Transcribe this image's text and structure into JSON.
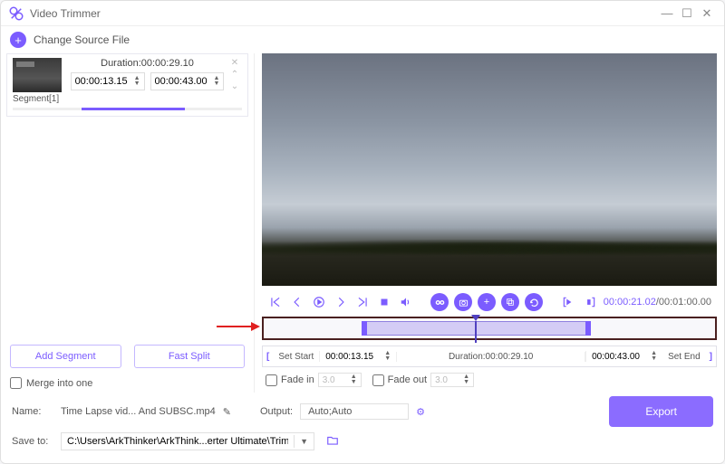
{
  "window": {
    "title": "Video Trimmer"
  },
  "header": {
    "change_source": "Change Source File"
  },
  "segment": {
    "duration_label": "Duration:00:00:29.10",
    "start_time": "00:00:13.15",
    "end_time": "00:00:43.00",
    "label": "Segment[1]"
  },
  "left": {
    "add_segment": "Add Segment",
    "fast_split": "Fast Split",
    "merge_label": "Merge into one"
  },
  "controls": {
    "current_time": "00:00:21.02",
    "total_time": "/00:01:00.00"
  },
  "setrow": {
    "set_start": "Set Start",
    "start_val": "00:00:13.15",
    "duration": "Duration:00:00:29.10",
    "end_val": "00:00:43.00",
    "set_end": "Set End"
  },
  "fade": {
    "in_label": "Fade in",
    "in_val": "3.0",
    "out_label": "Fade out",
    "out_val": "3.0"
  },
  "bottom": {
    "name_label": "Name:",
    "filename": "Time Lapse vid... And SUBSC.mp4",
    "output_label": "Output:",
    "output_val": "Auto;Auto",
    "saveto_label": "Save to:",
    "save_path": "C:\\Users\\ArkThinker\\ArkThink...erter Ultimate\\Trimmer",
    "export": "Export"
  }
}
